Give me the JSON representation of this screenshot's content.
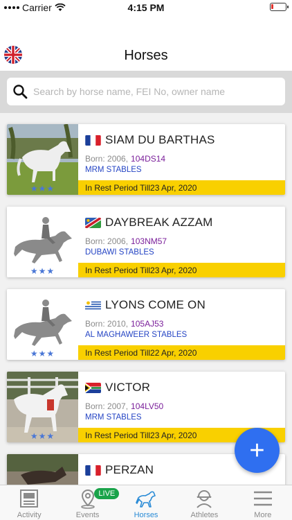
{
  "status_bar": {
    "carrier": "Carrier",
    "time": "4:15 PM"
  },
  "header": {
    "title": "Horses",
    "language_flag": "uk-flag-icon"
  },
  "search": {
    "placeholder": "Search by horse name, FEI No, owner name"
  },
  "horses": [
    {
      "name": "SIAM DU BARTHAS",
      "flag": "france",
      "born_label": "Born: 2006,",
      "fei": "104DS14",
      "stable": "MRM STABLES",
      "rest": "In Rest Period Till23 Apr, 2020",
      "stars": "★★★",
      "photo": "white-horse-photo"
    },
    {
      "name": "DAYBREAK AZZAM",
      "flag": "namibia",
      "born_label": "Born: 2006,",
      "fei": "103NM57",
      "stable": "DUBAWI STABLES",
      "rest": "In Rest Period Till23 Apr, 2020",
      "stars": "★★★",
      "photo": "placeholder-horse-rider-icon"
    },
    {
      "name": "LYONS COME ON",
      "flag": "uruguay",
      "born_label": "Born: 2010,",
      "fei": "105AJ53",
      "stable": "AL MAGHAWEER STABLES",
      "rest": "In Rest Period Till22 Apr, 2020",
      "stars": "★★★",
      "photo": "placeholder-horse-rider-icon"
    },
    {
      "name": "VICTOR",
      "flag": "south-africa",
      "born_label": "Born: 2007,",
      "fei": "104LV50",
      "stable": "MRM STABLES",
      "rest": "In Rest Period Till23 Apr, 2020",
      "stars": "★★★",
      "photo": "white-horse-photo"
    },
    {
      "name": "PERZAN",
      "flag": "france",
      "born_label": "",
      "fei": "",
      "stable": "",
      "rest": "",
      "stars": "",
      "photo": "horse-photo"
    }
  ],
  "fab": {
    "label": "+"
  },
  "tabs": [
    {
      "label": "Activity",
      "icon": "newspaper-icon"
    },
    {
      "label": "Events",
      "icon": "location-pin-icon",
      "badge": "LIVE"
    },
    {
      "label": "Horses",
      "icon": "horse-icon",
      "active": true
    },
    {
      "label": "Athletes",
      "icon": "athlete-helmet-icon"
    },
    {
      "label": "More",
      "icon": "menu-lines-icon"
    }
  ],
  "colors": {
    "accent": "#2f6ff0",
    "rest_bar": "#f9d000",
    "fei": "#7a1e9a",
    "stable": "#2444c4",
    "active_tab": "#2a8bd6",
    "live": "#1aa34a"
  }
}
